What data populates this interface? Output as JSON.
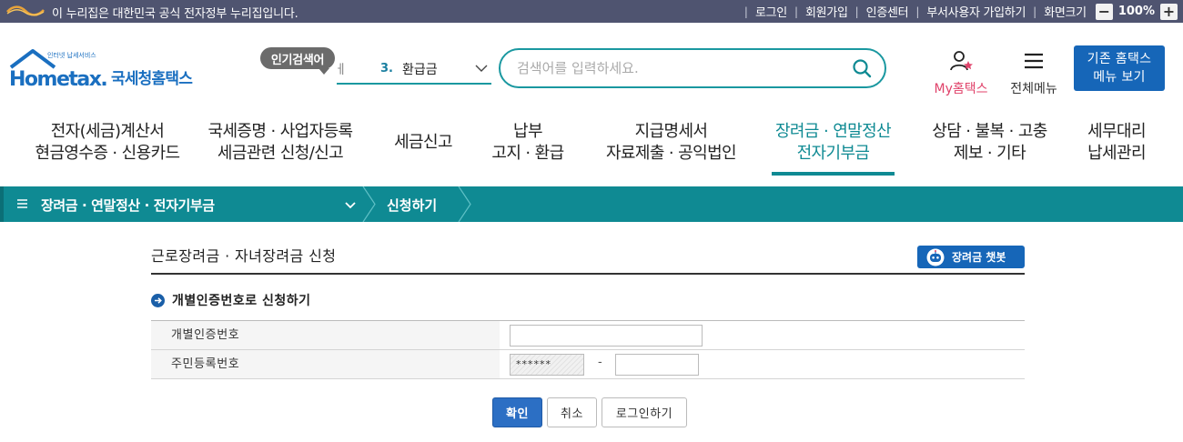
{
  "gov_banner": {
    "text": "이 누리집은 대한민국 공식 전자정부 누리집입니다.",
    "links": [
      "로그인",
      "회원가입",
      "인증센터",
      "부서사용자 가입하기",
      "화면크기"
    ],
    "zoom_minus": "−",
    "zoom_value": "100%",
    "zoom_plus": "+"
  },
  "header": {
    "logo_small": "인터넷 납세서비스",
    "logo_brand": "Hometax.",
    "logo_service": "국세청홈택스",
    "popular_label": "인기검색어",
    "popular_cut": "ㅔ",
    "popular_rank": "3.",
    "popular_term": "환급금",
    "search_placeholder": "검색어를 입력하세요.",
    "my_hometax": "My홈택스",
    "all_menu": "전체메뉴",
    "legacy_line1": "기존 홈택스",
    "legacy_line2": "메뉴 보기"
  },
  "gnb": [
    {
      "line1": "전자(세금)계산서",
      "line2": "현금영수증 · 신용카드"
    },
    {
      "line1": "국세증명 · 사업자등록",
      "line2": "세금관련 신청/신고"
    },
    {
      "line1": "세금신고",
      "line2": ""
    },
    {
      "line1": "납부",
      "line2": "고지 · 환급"
    },
    {
      "line1": "지급명세서",
      "line2": "자료제출 · 공익법인"
    },
    {
      "line1": "장려금 · 연말정산",
      "line2": "전자기부금"
    },
    {
      "line1": "상담 · 불복 · 고충",
      "line2": "제보 · 기타"
    },
    {
      "line1": "세무대리",
      "line2": "납세관리"
    }
  ],
  "breadcrumb": {
    "level1": "장려금 · 연말정산 · 전자기부금",
    "level2": "신청하기"
  },
  "content": {
    "page_title": "근로장려금 · 자녀장려금 신청",
    "chatbot_label": "장려금 챗봇",
    "section_title": "개별인증번호로 신청하기",
    "row1_label": "개별인증번호",
    "row1_value": "",
    "row2_label": "주민등록번호",
    "rrn_front": "******",
    "rrn_dash": "-",
    "rrn_back": "",
    "btn_confirm": "확인",
    "btn_cancel": "취소",
    "btn_login": "로그인하기"
  },
  "colors": {
    "gov_bar": "#4f5470",
    "teal": "#0f8a93",
    "blue": "#1666b8",
    "pink": "#e0426a"
  }
}
